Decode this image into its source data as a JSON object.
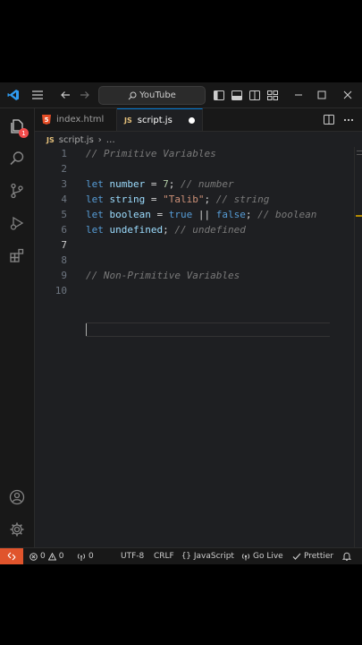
{
  "titlebar": {
    "search_label": "YouTube"
  },
  "activity": {
    "explorer_badge": "1"
  },
  "tabs": [
    {
      "label": "index.html"
    },
    {
      "label": "script.js"
    }
  ],
  "breadcrumb": {
    "file": "script.js",
    "rest": "…"
  },
  "editor": {
    "current_line": "7",
    "line_numbers": [
      "1",
      "2",
      "3",
      "4",
      "5",
      "6",
      "7",
      "8",
      "9",
      "10"
    ],
    "line1_comment": "// Primitive Variables",
    "line3": {
      "kw": "let",
      "var": "number",
      "eq": " = ",
      "val": "7",
      "semi": ";",
      "comment": " // number"
    },
    "line4": {
      "kw": "let",
      "var": "string",
      "eq": " = ",
      "val": "\"Talib\"",
      "semi": ";",
      "comment": " // string"
    },
    "line5": {
      "kw": "let",
      "var": "boolean",
      "eq": " = ",
      "val1": "true",
      "or": " || ",
      "val2": "false",
      "semi": ";",
      "comment": " // boolean"
    },
    "line6": {
      "kw": "let",
      "var": "undefined",
      "semi": ";",
      "comment": " // undefined"
    },
    "line9_comment": "// Non-Primitive Variables"
  },
  "status": {
    "errors": "0",
    "warnings": "0",
    "ports": "0",
    "encoding": "UTF-8",
    "eol": "CRLF",
    "language": "JavaScript",
    "golive": "Go Live",
    "prettier": "Prettier"
  },
  "colors": {
    "accent": "#0078d4",
    "remote": "#e0542c",
    "badge": "#f14c4c"
  }
}
